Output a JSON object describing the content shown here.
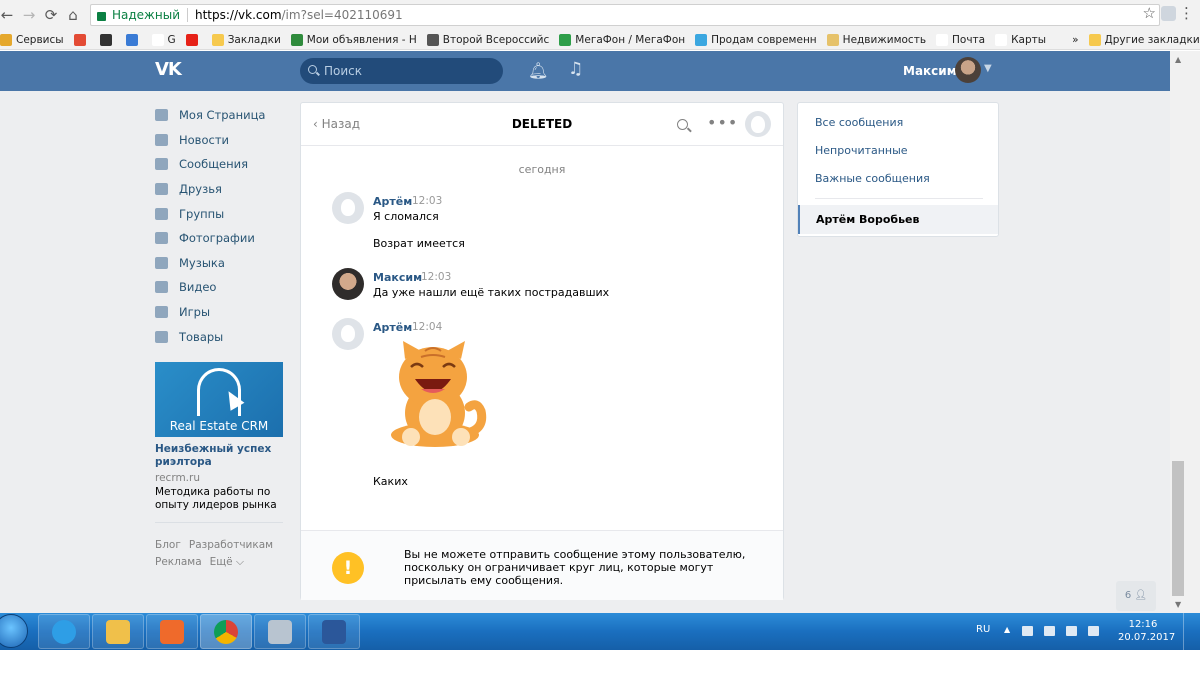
{
  "browser": {
    "secure_label": "Надежный",
    "url_host": "https://vk.com",
    "url_path": "/im?sel=402110691",
    "bookmarks": [
      {
        "label": "Сервисы",
        "color": "#e5a82d"
      },
      {
        "label": "",
        "color": "#e34b35"
      },
      {
        "label": "",
        "color": "#333333"
      },
      {
        "label": "",
        "color": "#3a7bd5"
      },
      {
        "label": "G",
        "color": "#ffffff"
      },
      {
        "label": "",
        "color": "#e62117"
      },
      {
        "label": "Закладки",
        "color": "#f6c94e"
      },
      {
        "label": "Мои объявления - Н",
        "color": "#2f8b3c"
      },
      {
        "label": "Второй Всероссийс",
        "color": "#555555"
      },
      {
        "label": "МегаФон / МегаФон",
        "color": "#2e9e49"
      },
      {
        "label": "Продам современн",
        "color": "#3ba7e0"
      },
      {
        "label": "Недвижимость",
        "color": "#e6c26a"
      },
      {
        "label": "Почта",
        "color": "#ffffff"
      },
      {
        "label": "Карты",
        "color": "#ffffff"
      },
      {
        "label": "»",
        "color": "#f2f2f2"
      },
      {
        "label": "Другие закладки",
        "color": "#f6c94e"
      }
    ]
  },
  "vk_header": {
    "logo": "VK",
    "search_placeholder": "Поиск",
    "user_name": "Максим"
  },
  "left_nav": {
    "items": [
      {
        "label": "Моя Страница",
        "icon": "home-icon"
      },
      {
        "label": "Новости",
        "icon": "news-icon"
      },
      {
        "label": "Сообщения",
        "icon": "messages-icon"
      },
      {
        "label": "Друзья",
        "icon": "friends-icon"
      },
      {
        "label": "Группы",
        "icon": "groups-icon"
      },
      {
        "label": "Фотографии",
        "icon": "photos-icon"
      },
      {
        "label": "Музыка",
        "icon": "music-icon"
      },
      {
        "label": "Видео",
        "icon": "video-icon"
      },
      {
        "label": "Игры",
        "icon": "games-icon"
      },
      {
        "label": "Товары",
        "icon": "goods-icon"
      }
    ]
  },
  "ad": {
    "banner_caption": "Real Estate CRM",
    "title": "Неизбежный успех риэлтора",
    "domain": "recrm.ru",
    "description": "Методика работы по опыту лидеров рынка"
  },
  "footer": {
    "blog": "Блог",
    "developers": "Разработчикам",
    "ads": "Реклама",
    "more": "Ещё ⌵"
  },
  "chat": {
    "back_label": "Назад",
    "title": "DELETED",
    "date_separator": "сегодня",
    "messages": [
      {
        "author": "Артём",
        "time": "12:03",
        "lines": [
          "Я сломался",
          "Возрат имеется"
        ]
      },
      {
        "author": "Максим",
        "time": "12:03",
        "lines": [
          "Да уже нашли ещё таких пострадавших"
        ]
      },
      {
        "author": "Артём",
        "time": "12:04",
        "lines": [
          "Каких"
        ]
      }
    ],
    "warning": "Вы не можете отправить сообщение этому пользователю, поскольку он ограничивает круг лиц, которые могут присылать ему сообщения."
  },
  "filters": {
    "all": "Все сообщения",
    "unread": "Непрочитанные",
    "important": "Важные сообщения",
    "active_chat": "Артём Воробьев"
  },
  "online_count": "6",
  "taskbar": {
    "lang": "RU",
    "time": "12:16",
    "date": "20.07.2017"
  }
}
